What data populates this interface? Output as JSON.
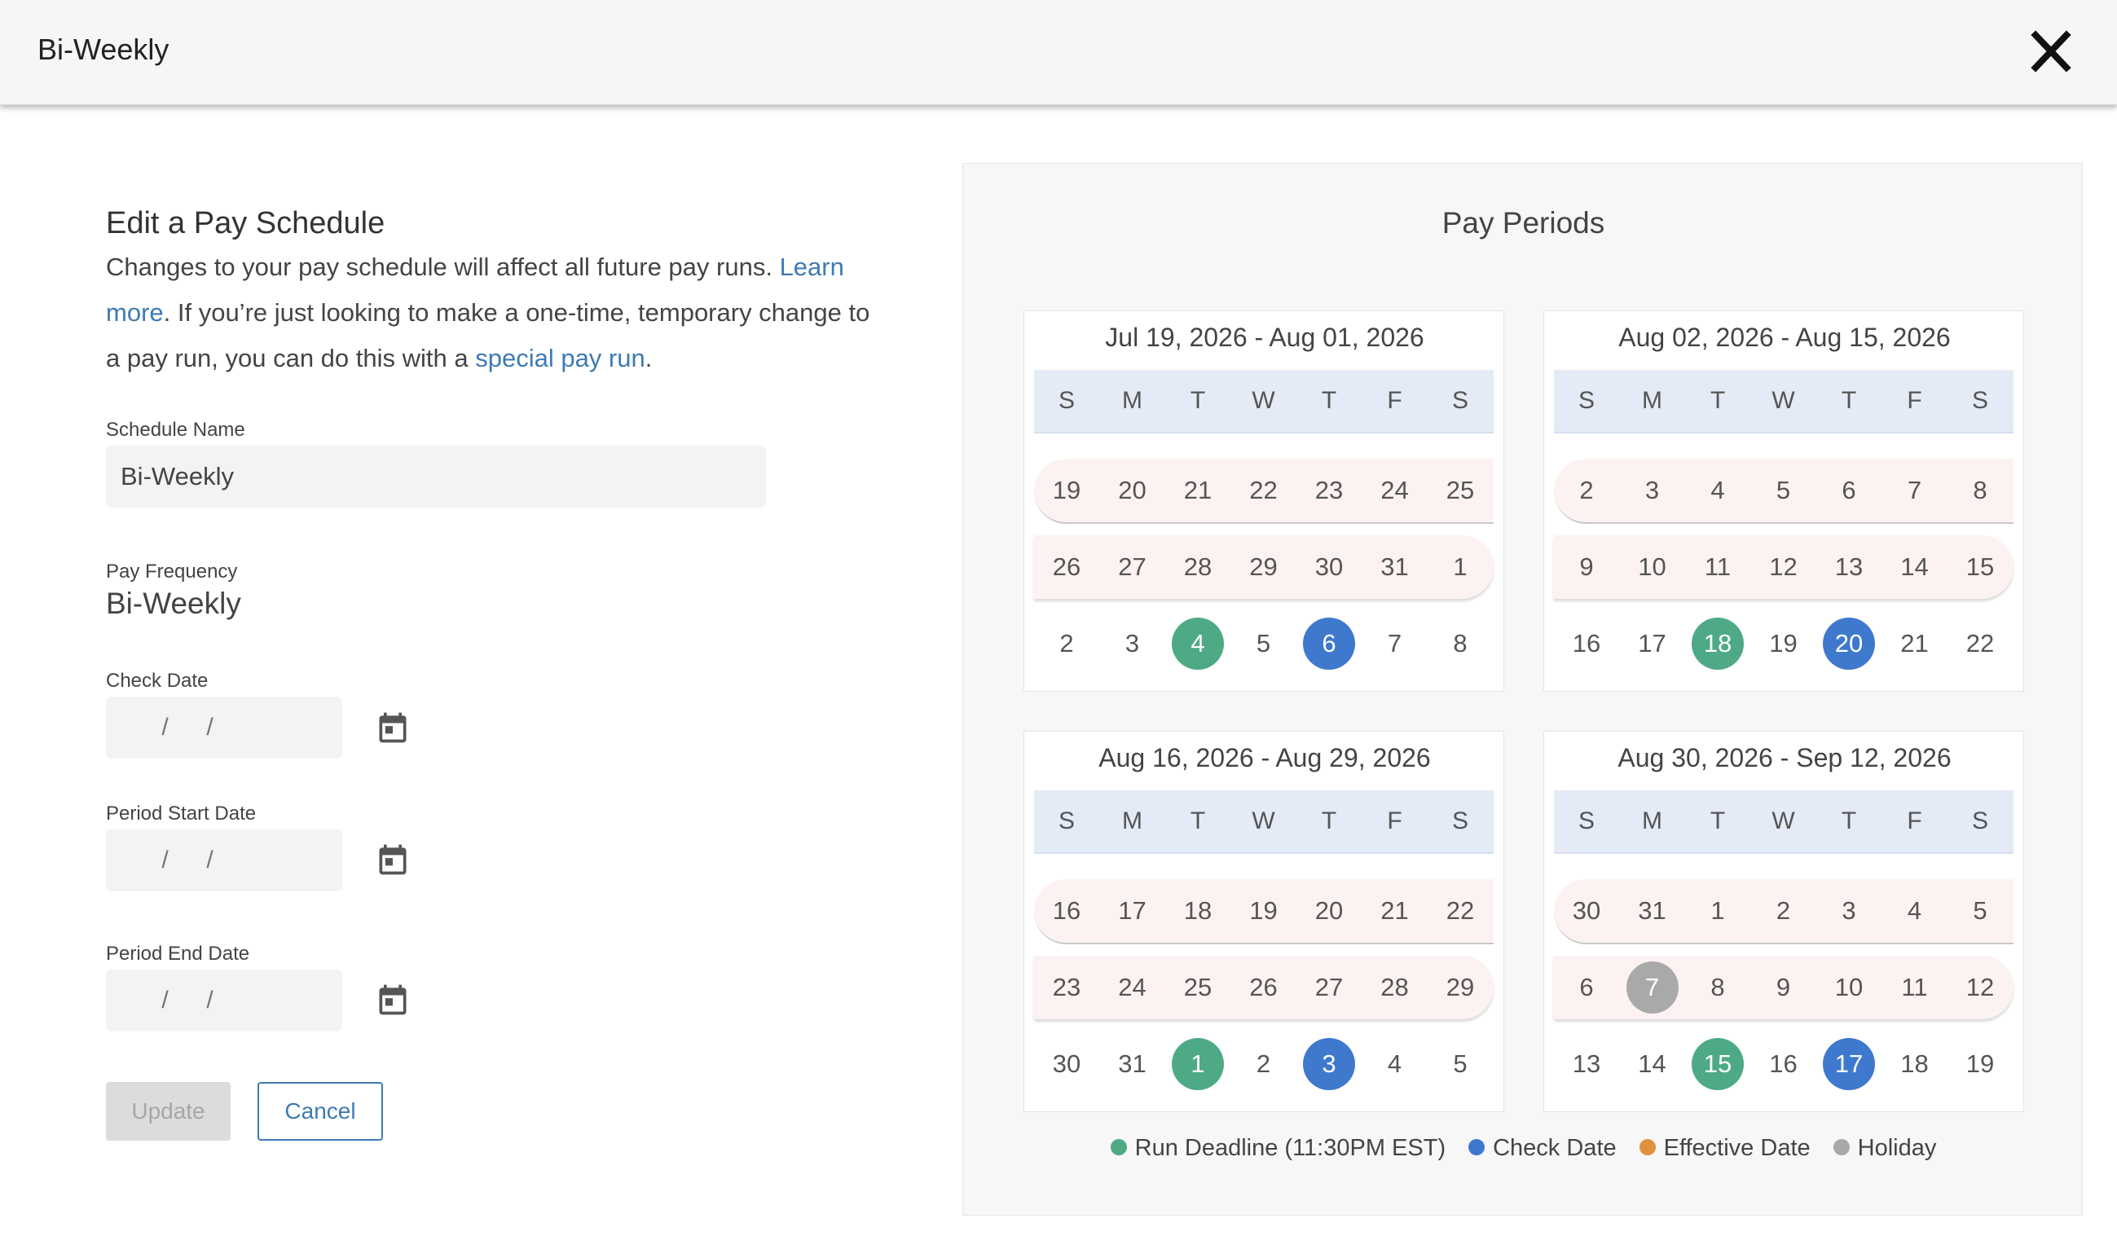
{
  "header": {
    "title": "Bi-Weekly"
  },
  "form": {
    "heading": "Edit a Pay Schedule",
    "desc_1": "Changes to your pay schedule will affect all future pay runs. ",
    "learn_more": "Learn more",
    "desc_2": ". If you’re just looking to make a one-time, temporary change to a pay run, you can do this with a ",
    "special_pay_run": "special pay run",
    "desc_3": ".",
    "schedule_name_label": "Schedule Name",
    "schedule_name_value": "Bi-Weekly",
    "pay_frequency_label": "Pay Frequency",
    "pay_frequency_value": "Bi-Weekly",
    "check_date_label": "Check Date",
    "period_start_label": "Period Start Date",
    "period_end_label": "Period End Date",
    "date_placeholder": " /  / ",
    "update_label": "Update",
    "cancel_label": "Cancel"
  },
  "panel": {
    "title": "Pay Periods",
    "dow": [
      "S",
      "M",
      "T",
      "W",
      "T",
      "F",
      "S"
    ],
    "calendars": [
      {
        "range": "Jul 19, 2026 - Aug 01, 2026",
        "weeks": [
          [
            "19",
            "20",
            "21",
            "22",
            "23",
            "24",
            "25"
          ],
          [
            "26",
            "27",
            "28",
            "29",
            "30",
            "31",
            "1"
          ],
          [
            "2",
            "3",
            "4",
            "5",
            "6",
            "7",
            "8"
          ]
        ],
        "marks": {
          "2-2": "run",
          "2-4": "check"
        }
      },
      {
        "range": "Aug 02, 2026 - Aug 15, 2026",
        "weeks": [
          [
            "2",
            "3",
            "4",
            "5",
            "6",
            "7",
            "8"
          ],
          [
            "9",
            "10",
            "11",
            "12",
            "13",
            "14",
            "15"
          ],
          [
            "16",
            "17",
            "18",
            "19",
            "20",
            "21",
            "22"
          ]
        ],
        "marks": {
          "2-2": "run",
          "2-4": "check"
        }
      },
      {
        "range": "Aug 16, 2026 - Aug 29, 2026",
        "weeks": [
          [
            "16",
            "17",
            "18",
            "19",
            "20",
            "21",
            "22"
          ],
          [
            "23",
            "24",
            "25",
            "26",
            "27",
            "28",
            "29"
          ],
          [
            "30",
            "31",
            "1",
            "2",
            "3",
            "4",
            "5"
          ]
        ],
        "marks": {
          "2-2": "run",
          "2-4": "check"
        }
      },
      {
        "range": "Aug 30, 2026 - Sep 12, 2026",
        "weeks": [
          [
            "30",
            "31",
            "1",
            "2",
            "3",
            "4",
            "5"
          ],
          [
            "6",
            "7",
            "8",
            "9",
            "10",
            "11",
            "12"
          ],
          [
            "13",
            "14",
            "15",
            "16",
            "17",
            "18",
            "19"
          ]
        ],
        "marks": {
          "1-1": "holiday",
          "2-2": "run",
          "2-4": "check"
        }
      }
    ],
    "legend": [
      {
        "label": "Run Deadline (11:30PM EST)",
        "color": "#4eaa84"
      },
      {
        "label": "Check Date",
        "color": "#3f79ce"
      },
      {
        "label": "Effective Date",
        "color": "#e0913f"
      },
      {
        "label": "Holiday",
        "color": "#a9a9a9"
      }
    ]
  }
}
